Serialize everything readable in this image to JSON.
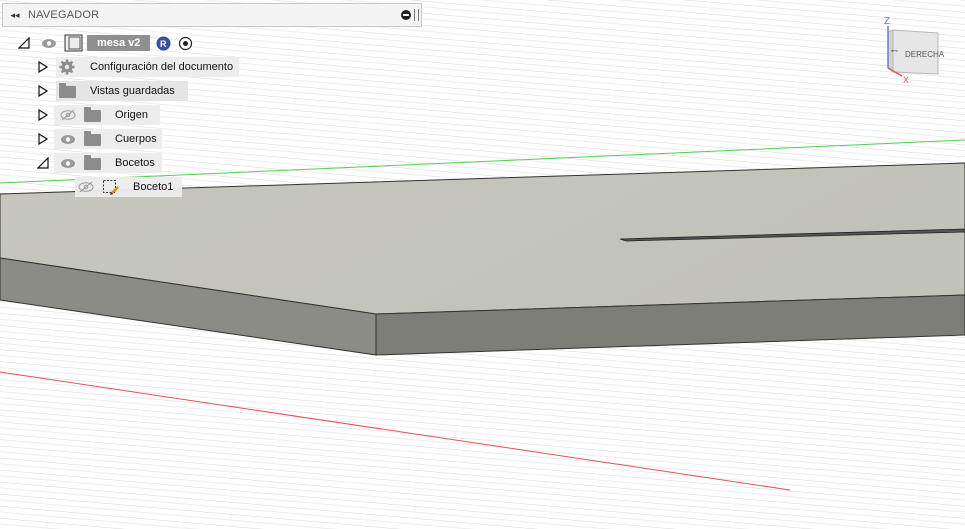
{
  "navigator": {
    "title": "NAVEGADOR",
    "root": {
      "name": "mesa v2"
    },
    "items": [
      {
        "label": "Configuración del documento"
      },
      {
        "label": "Vistas guardadas"
      },
      {
        "label": "Origen"
      },
      {
        "label": "Cuerpos"
      },
      {
        "label": "Bocetos"
      },
      {
        "label": "Boceto1"
      }
    ]
  },
  "viewcube": {
    "face_label": "DERECHA",
    "axis_z": "Z",
    "axis_x": "X"
  },
  "colors": {
    "panel_bg": "#f4f4f4",
    "root_label_bg": "#8f8f8f",
    "badge_blue": "#3a4f9e",
    "x_axis": "#e05555",
    "y_axis": "#55cc55"
  }
}
